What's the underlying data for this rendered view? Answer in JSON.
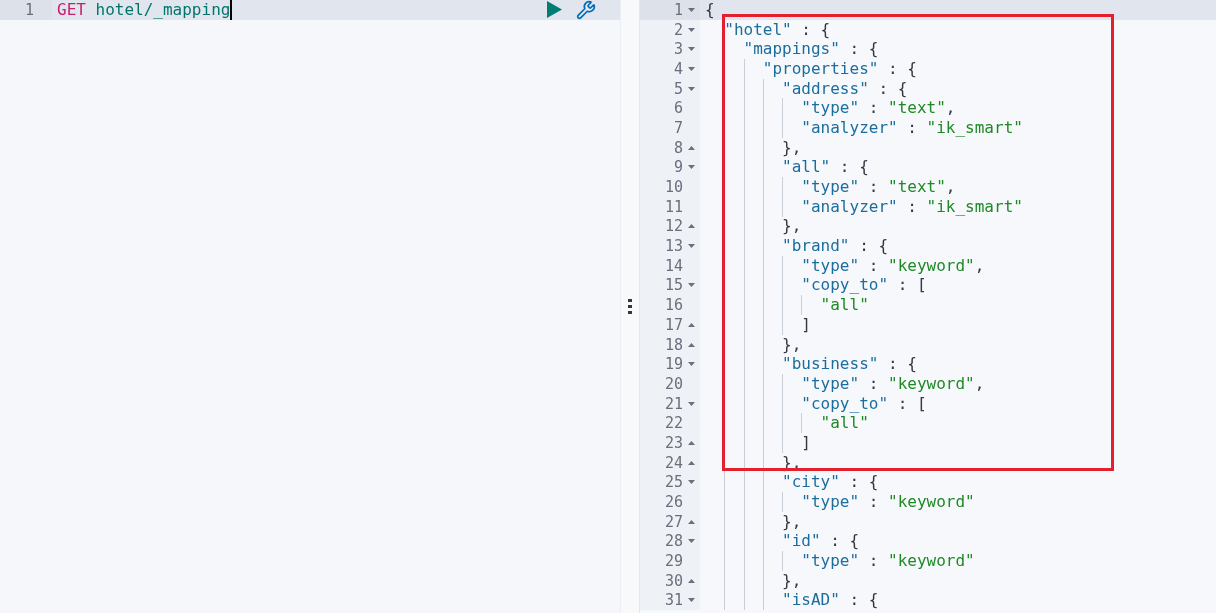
{
  "request": {
    "cursor": true,
    "lines": [
      {
        "number": "1",
        "active": true,
        "tokens": [
          {
            "kind": "method",
            "text": "GET"
          },
          {
            "kind": "path",
            "text": "hotel/_mapping"
          }
        ]
      }
    ]
  },
  "response": {
    "lines": [
      {
        "number": "1",
        "active": true,
        "tokens": [
          {
            "kind": "punct",
            "text": "{"
          }
        ]
      },
      {
        "number": "2",
        "active": false,
        "tokens": [
          {
            "kind": "key",
            "text": "\"hotel\""
          },
          {
            "kind": "punct",
            "text": " : {"
          }
        ]
      },
      {
        "number": "3",
        "active": false,
        "tokens": [
          {
            "kind": "key",
            "text": "\"mappings\""
          },
          {
            "kind": "punct",
            "text": " : {"
          }
        ]
      },
      {
        "number": "4",
        "active": false,
        "tokens": [
          {
            "kind": "key",
            "text": "\"properties\""
          },
          {
            "kind": "punct",
            "text": " : {"
          }
        ]
      },
      {
        "number": "5",
        "active": false,
        "tokens": [
          {
            "kind": "key",
            "text": "\"address\""
          },
          {
            "kind": "punct",
            "text": " : {"
          }
        ]
      },
      {
        "number": "6",
        "active": false,
        "tokens": [
          {
            "kind": "key",
            "text": "\"type\""
          },
          {
            "kind": "punct",
            "text": " : "
          },
          {
            "kind": "string",
            "text": "\"text\""
          },
          {
            "kind": "punct",
            "text": ","
          }
        ]
      },
      {
        "number": "7",
        "active": false,
        "tokens": [
          {
            "kind": "key",
            "text": "\"analyzer\""
          },
          {
            "kind": "punct",
            "text": " : "
          },
          {
            "kind": "string",
            "text": "\"ik_smart\""
          }
        ]
      },
      {
        "number": "8",
        "active": false,
        "tokens": [
          {
            "kind": "punct",
            "text": "},"
          }
        ]
      },
      {
        "number": "9",
        "active": false,
        "tokens": [
          {
            "kind": "key",
            "text": "\"all\""
          },
          {
            "kind": "punct",
            "text": " : {"
          }
        ]
      },
      {
        "number": "10",
        "active": false,
        "tokens": [
          {
            "kind": "key",
            "text": "\"type\""
          },
          {
            "kind": "punct",
            "text": " : "
          },
          {
            "kind": "string",
            "text": "\"text\""
          },
          {
            "kind": "punct",
            "text": ","
          }
        ]
      },
      {
        "number": "11",
        "active": false,
        "tokens": [
          {
            "kind": "key",
            "text": "\"analyzer\""
          },
          {
            "kind": "punct",
            "text": " : "
          },
          {
            "kind": "string",
            "text": "\"ik_smart\""
          }
        ]
      },
      {
        "number": "12",
        "active": false,
        "tokens": [
          {
            "kind": "punct",
            "text": "},"
          }
        ]
      },
      {
        "number": "13",
        "active": false,
        "tokens": [
          {
            "kind": "key",
            "text": "\"brand\""
          },
          {
            "kind": "punct",
            "text": " : {"
          }
        ]
      },
      {
        "number": "14",
        "active": false,
        "tokens": [
          {
            "kind": "key",
            "text": "\"type\""
          },
          {
            "kind": "punct",
            "text": " : "
          },
          {
            "kind": "string",
            "text": "\"keyword\""
          },
          {
            "kind": "punct",
            "text": ","
          }
        ]
      },
      {
        "number": "15",
        "active": false,
        "tokens": [
          {
            "kind": "key",
            "text": "\"copy_to\""
          },
          {
            "kind": "punct",
            "text": " : ["
          }
        ]
      },
      {
        "number": "16",
        "active": false,
        "tokens": [
          {
            "kind": "string",
            "text": "\"all\""
          }
        ]
      },
      {
        "number": "17",
        "active": false,
        "tokens": [
          {
            "kind": "punct",
            "text": "]"
          }
        ]
      },
      {
        "number": "18",
        "active": false,
        "tokens": [
          {
            "kind": "punct",
            "text": "},"
          }
        ]
      },
      {
        "number": "19",
        "active": false,
        "tokens": [
          {
            "kind": "key",
            "text": "\"business\""
          },
          {
            "kind": "punct",
            "text": " : {"
          }
        ]
      },
      {
        "number": "20",
        "active": false,
        "tokens": [
          {
            "kind": "key",
            "text": "\"type\""
          },
          {
            "kind": "punct",
            "text": " : "
          },
          {
            "kind": "string",
            "text": "\"keyword\""
          },
          {
            "kind": "punct",
            "text": ","
          }
        ]
      },
      {
        "number": "21",
        "active": false,
        "tokens": [
          {
            "kind": "key",
            "text": "\"copy_to\""
          },
          {
            "kind": "punct",
            "text": " : ["
          }
        ]
      },
      {
        "number": "22",
        "active": false,
        "tokens": [
          {
            "kind": "string",
            "text": "\"all\""
          }
        ]
      },
      {
        "number": "23",
        "active": false,
        "tokens": [
          {
            "kind": "punct",
            "text": "]"
          }
        ]
      },
      {
        "number": "24",
        "active": false,
        "tokens": [
          {
            "kind": "punct",
            "text": "},"
          }
        ]
      },
      {
        "number": "25",
        "active": false,
        "tokens": [
          {
            "kind": "key",
            "text": "\"city\""
          },
          {
            "kind": "punct",
            "text": " : {"
          }
        ]
      },
      {
        "number": "26",
        "active": false,
        "tokens": [
          {
            "kind": "key",
            "text": "\"type\""
          },
          {
            "kind": "punct",
            "text": " : "
          },
          {
            "kind": "string",
            "text": "\"keyword\""
          }
        ]
      },
      {
        "number": "27",
        "active": false,
        "tokens": [
          {
            "kind": "punct",
            "text": "},"
          }
        ]
      },
      {
        "number": "28",
        "active": false,
        "tokens": [
          {
            "kind": "key",
            "text": "\"id\""
          },
          {
            "kind": "punct",
            "text": " : {"
          }
        ]
      },
      {
        "number": "29",
        "active": false,
        "tokens": [
          {
            "kind": "key",
            "text": "\"type\""
          },
          {
            "kind": "punct",
            "text": " : "
          },
          {
            "kind": "string",
            "text": "\"keyword\""
          }
        ]
      },
      {
        "number": "30",
        "active": false,
        "tokens": [
          {
            "kind": "punct",
            "text": "},"
          }
        ]
      },
      {
        "number": "31",
        "active": false,
        "tokens": [
          {
            "kind": "key",
            "text": "\"isAD\""
          },
          {
            "kind": "punct",
            "text": " : {"
          }
        ]
      }
    ]
  },
  "annotation": {
    "kind": "rectangle"
  }
}
